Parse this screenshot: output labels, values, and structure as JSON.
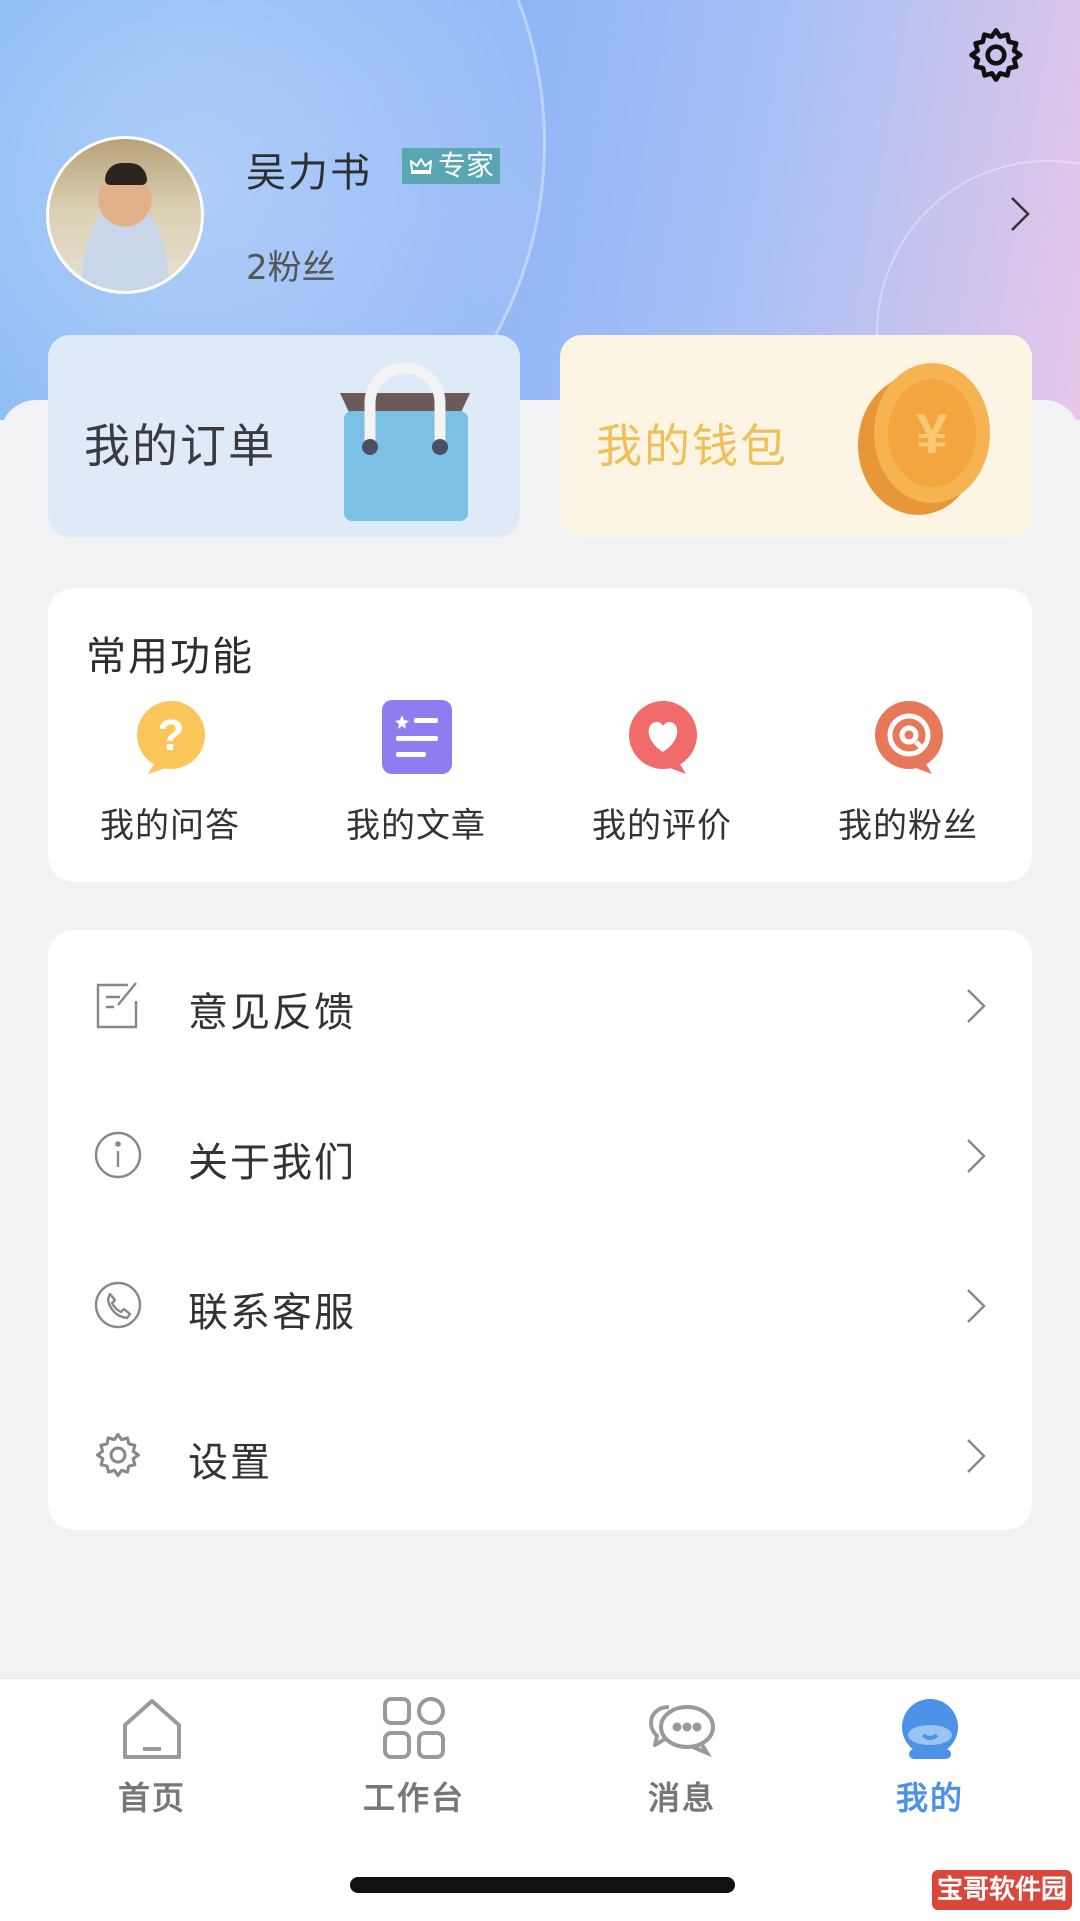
{
  "header": {
    "user_name": "吴力书",
    "badge_label": "专家",
    "fans_label": "2粉丝",
    "icons": [
      "gear-icon",
      "crown-icon",
      "chevron-right-icon"
    ]
  },
  "cards": {
    "order_label": "我的订单",
    "wallet_label": "我的钱包"
  },
  "functions": {
    "title": "常用功能",
    "items": [
      {
        "label": "我的问答",
        "icon": "question-bubble-icon",
        "color": "#f9c74f"
      },
      {
        "label": "我的文章",
        "icon": "article-icon",
        "color": "#8f7cf0"
      },
      {
        "label": "我的评价",
        "icon": "heart-bubble-icon",
        "color": "#f16b6b"
      },
      {
        "label": "我的粉丝",
        "icon": "target-bubble-icon",
        "color": "#e8785a"
      }
    ]
  },
  "menu": {
    "items": [
      {
        "label": "意见反馈",
        "icon": "feedback-icon"
      },
      {
        "label": "关于我们",
        "icon": "info-icon"
      },
      {
        "label": "联系客服",
        "icon": "phone-icon"
      },
      {
        "label": "设置",
        "icon": "gear-icon"
      }
    ]
  },
  "tabbar": {
    "items": [
      {
        "label": "首页",
        "icon": "home-icon",
        "active": false
      },
      {
        "label": "工作台",
        "icon": "grid-icon",
        "active": false
      },
      {
        "label": "消息",
        "icon": "message-icon",
        "active": false
      },
      {
        "label": "我的",
        "icon": "profile-icon",
        "active": true
      }
    ],
    "active_color": "#4b92e8"
  },
  "watermark": "宝哥软件园"
}
